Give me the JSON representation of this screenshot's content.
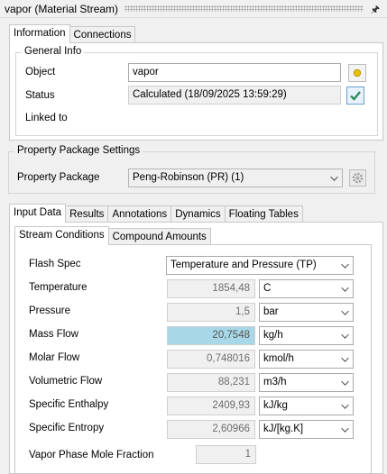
{
  "window": {
    "title": "vapor (Material Stream)"
  },
  "top_tabs": [
    "Information",
    "Connections"
  ],
  "general_info": {
    "title": "General Info",
    "object_label": "Object",
    "object_value": "vapor",
    "status_label": "Status",
    "status_value": "Calculated (18/09/2025 13:59:29)",
    "linked_label": "Linked to"
  },
  "property_package": {
    "title": "Property Package Settings",
    "label": "Property Package",
    "value": "Peng-Robinson (PR) (1)"
  },
  "data_tabs": [
    "Input Data",
    "Results",
    "Annotations",
    "Dynamics",
    "Floating Tables"
  ],
  "sub_tabs": [
    "Stream Conditions",
    "Compound Amounts"
  ],
  "stream_conditions": {
    "flash_spec_label": "Flash Spec",
    "flash_spec_value": "Temperature and Pressure (TP)",
    "rows": [
      {
        "label": "Temperature",
        "value": "1854,48",
        "unit": "C"
      },
      {
        "label": "Pressure",
        "value": "1,5",
        "unit": "bar"
      },
      {
        "label": "Mass Flow",
        "value": "20,7548",
        "unit": "kg/h"
      },
      {
        "label": "Molar Flow",
        "value": "0,748016",
        "unit": "kmol/h"
      },
      {
        "label": "Volumetric Flow",
        "value": "88,231",
        "unit": "m3/h"
      },
      {
        "label": "Specific Enthalpy",
        "value": "2409,93",
        "unit": "kJ/kg"
      },
      {
        "label": "Specific Entropy",
        "value": "2,60966",
        "unit": "kJ/[kg.K]"
      }
    ],
    "vapor_fraction_label": "Vapor Phase Mole Fraction",
    "vapor_fraction_value": "1"
  },
  "icons": {
    "title_pin": "pin-icon",
    "object_button": "color-dot-icon",
    "status_button": "checkmark-icon",
    "pp_button": "gear-icon"
  },
  "colors": {
    "highlight": "#a8d8e8",
    "check": "#2e8b57",
    "dot": "#e8c000"
  }
}
